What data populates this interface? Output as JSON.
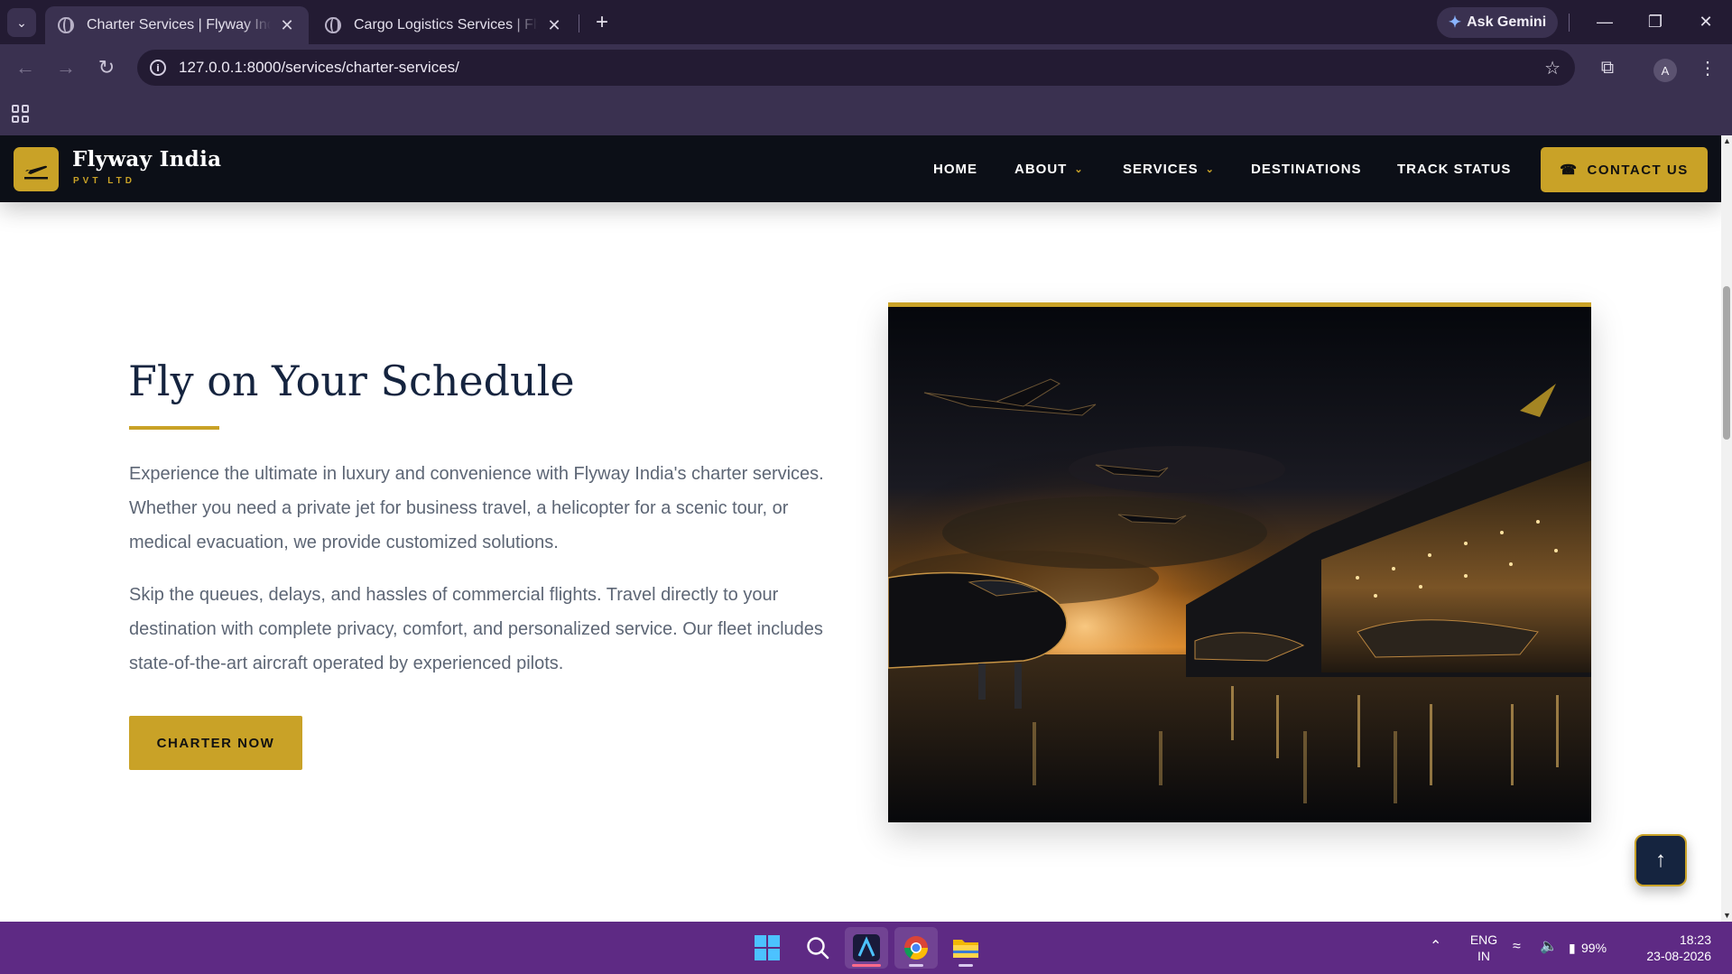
{
  "browser": {
    "tabs": [
      {
        "title": "Charter Services | Flyway India Pvt Ltd",
        "active": true
      },
      {
        "title": "Cargo Logistics Services | Flyway India Pvt Ltd",
        "active": false
      }
    ],
    "ask_gemini": "Ask Gemini",
    "url": "127.0.0.1:8000/services/charter-services/",
    "profile_initial": "A"
  },
  "site": {
    "brand": {
      "name": "Flyway India",
      "sub": "PVT LTD"
    },
    "nav": {
      "home": "HOME",
      "about": "ABOUT",
      "services": "SERVICES",
      "destinations": "DESTINATIONS",
      "track": "TRACK STATUS",
      "contact": "CONTACT US"
    },
    "hero": {
      "title": "Fly on Your Schedule",
      "paragraph1": "Experience the ultimate in luxury and convenience with Flyway India's charter services. Whether you need a private jet for business travel, a helicopter for a scenic tour, or medical evacuation, we provide customized solutions.",
      "paragraph2": "Skip the queues, delays, and hassles of commercial flights. Travel directly to your destination with complete privacy, comfort, and personalized service. Our fleet includes state-of-the-art aircraft operated by experienced pilots.",
      "cta": "CHARTER NOW"
    }
  },
  "taskbar": {
    "lang": "ENG",
    "region": "IN",
    "battery": "99%",
    "time": "18:23",
    "date": "23-08-2026"
  },
  "colors": {
    "accent": "#c9a227",
    "navy": "#15243f",
    "nav_bg": "#0c0f17",
    "taskbar": "#5e2a84"
  }
}
